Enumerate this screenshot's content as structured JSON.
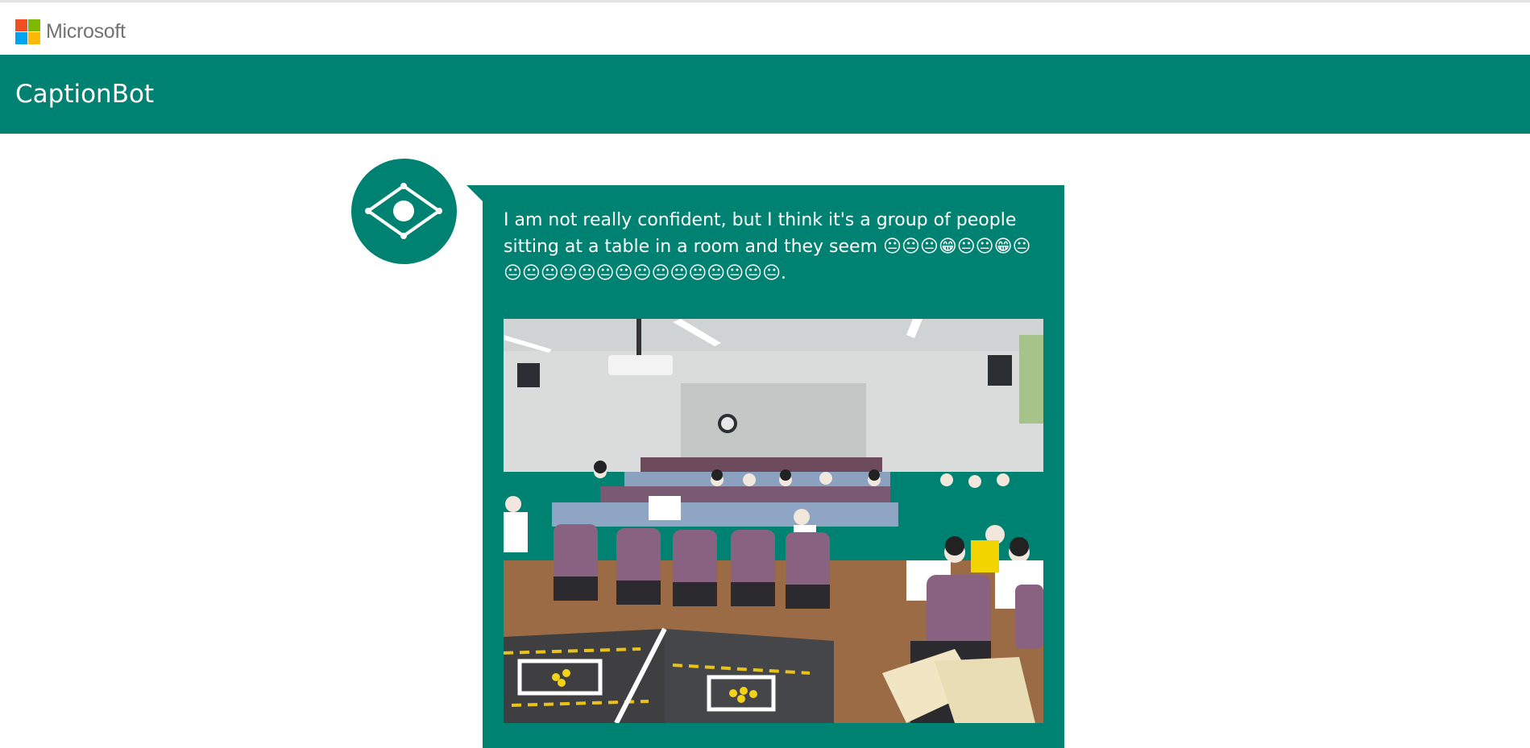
{
  "header": {
    "brand": "Microsoft",
    "logo_colors": [
      "#f25022",
      "#7fba00",
      "#00a4ef",
      "#ffb900"
    ]
  },
  "banner": {
    "title": "CaptionBot",
    "color": "#008272"
  },
  "bot": {
    "avatar_icon": "captionbot-eye-icon"
  },
  "message": {
    "caption_text": "I am not really confident, but I think it's a group of people sitting at a table in a room and they seem 😐😐😐😁😐😐😁😐😐😐😐😐😐😐😐😐😐😐😐😐😐😐😐.",
    "photo_subject": "lecture-hall-photo"
  }
}
